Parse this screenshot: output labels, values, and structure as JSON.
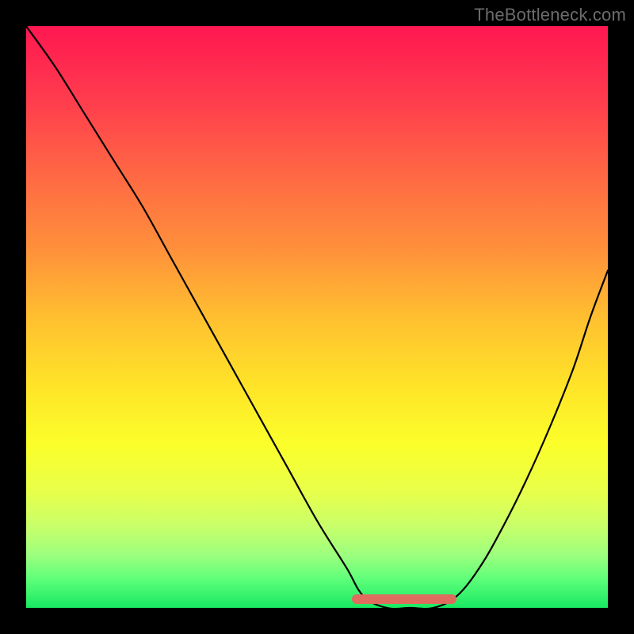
{
  "watermark": "TheBottleneck.com",
  "colors": {
    "frame_bg": "#000000",
    "gradient_top": "#ff1751",
    "gradient_mid": "#ffe428",
    "gradient_bottom": "#18e862",
    "curve_stroke": "#000000",
    "bar_fill": "#e06b5f"
  },
  "chart_data": {
    "type": "line",
    "title": "",
    "xlabel": "",
    "ylabel": "",
    "xlim": [
      0,
      100
    ],
    "ylim": [
      0,
      100
    ],
    "series": [
      {
        "name": "bottleneck-curve",
        "x": [
          0,
          5,
          10,
          15,
          20,
          25,
          30,
          35,
          40,
          45,
          50,
          55,
          58,
          62,
          66,
          70,
          74,
          78,
          82,
          86,
          90,
          94,
          97,
          100
        ],
        "values": [
          100,
          93,
          85,
          77,
          69,
          60,
          51,
          42,
          33,
          24,
          15,
          7,
          2,
          0,
          0,
          0,
          2,
          7,
          14,
          22,
          31,
          41,
          50,
          58
        ]
      }
    ],
    "annotations": [
      {
        "name": "valley-bar",
        "x_start": 56,
        "x_end": 74,
        "y": 1.5
      }
    ]
  }
}
